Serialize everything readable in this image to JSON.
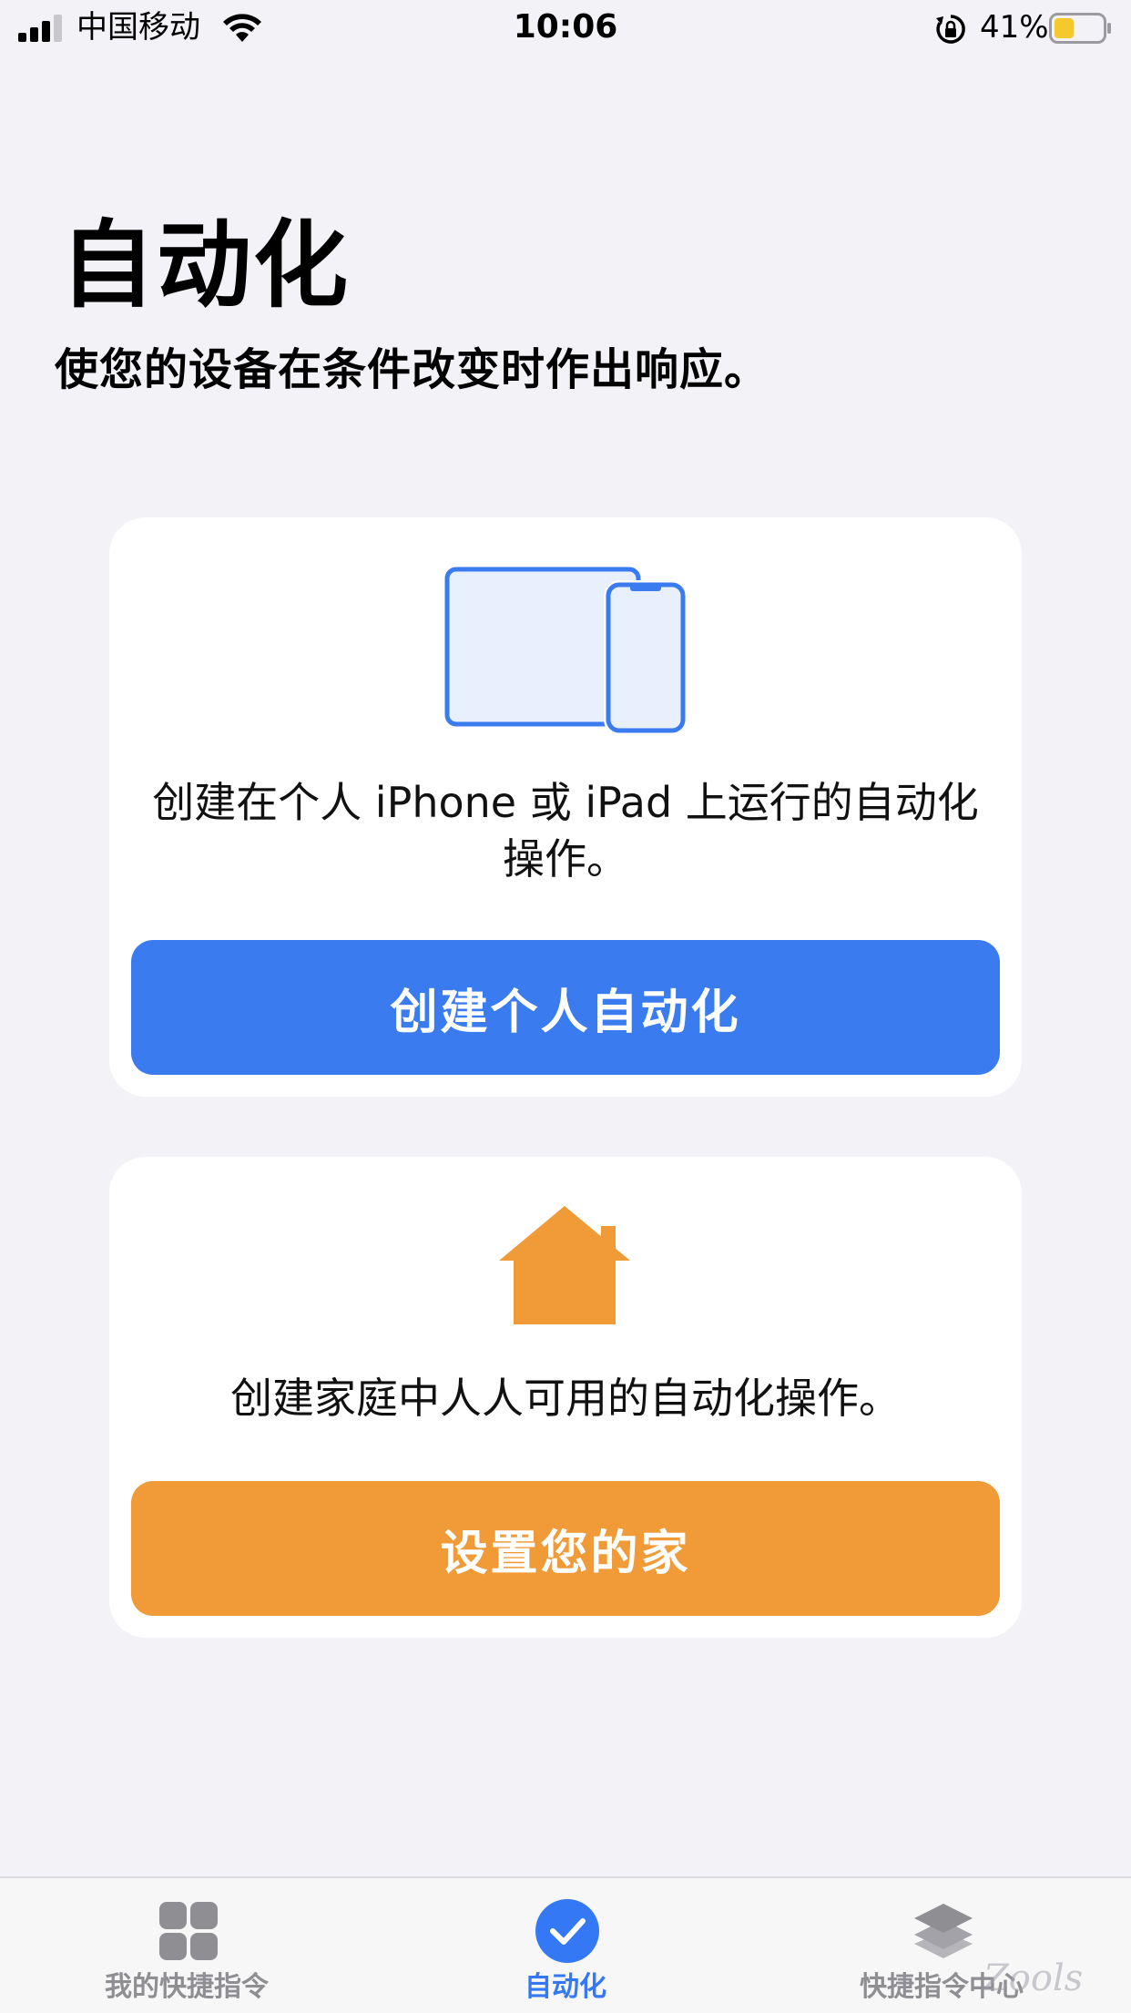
{
  "status_bar": {
    "carrier": "中国移动",
    "time": "10:06",
    "battery_percent": "41%",
    "battery_level": 0.41,
    "icons": [
      "signal-icon",
      "wifi-icon",
      "rotation-lock-icon",
      "battery-icon"
    ]
  },
  "header": {
    "title": "自动化",
    "subtitle": "使您的设备在条件改变时作出响应。"
  },
  "cards": {
    "personal": {
      "icon": "devices-icon",
      "description": "创建在个人 iPhone 或 iPad 上运行的自动化操作。",
      "button_label": "创建个人自动化",
      "button_color": "#3a7bf0"
    },
    "home": {
      "icon": "house-icon",
      "description": "创建家庭中人人可用的自动化操作。",
      "button_label": "设置您的家",
      "button_color": "#f09a38"
    }
  },
  "tab_bar": {
    "tabs": [
      {
        "label": "我的快捷指令",
        "icon": "grid-icon",
        "active": false
      },
      {
        "label": "自动化",
        "icon": "checkmark-circle-icon",
        "active": true
      },
      {
        "label": "快捷指令中心",
        "icon": "layers-icon",
        "active": false
      }
    ],
    "active_color": "#3478f6",
    "inactive_color": "#8e8e93"
  },
  "watermark": "Zools"
}
